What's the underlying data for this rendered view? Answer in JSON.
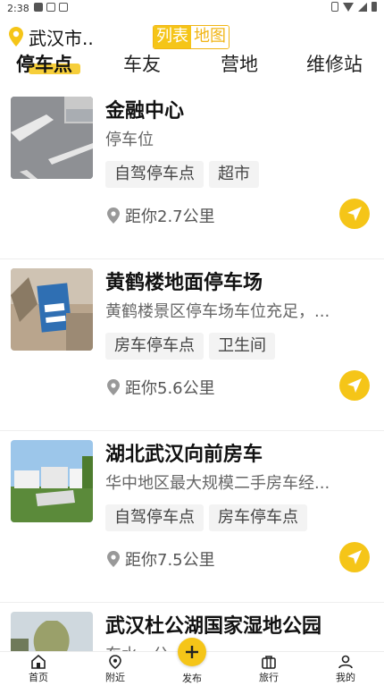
{
  "status_bar": {
    "time": "2:38"
  },
  "header": {
    "city": "武汉市..",
    "view_toggle": {
      "list": "列表",
      "map": "地图"
    }
  },
  "tabs": [
    {
      "label": "停车点",
      "active": true
    },
    {
      "label": "车友",
      "active": false
    },
    {
      "label": "营地",
      "active": false
    },
    {
      "label": "维修站",
      "active": false
    }
  ],
  "items": [
    {
      "title": "金融中心",
      "desc": "停车位",
      "tags": [
        "自驾停车点",
        "超市"
      ],
      "distance": "距你2.7公里"
    },
    {
      "title": "黄鹤楼地面停车场",
      "desc": "黄鹤楼景区停车场车位充足，...",
      "tags": [
        "房车停车点",
        "卫生间"
      ],
      "distance": "距你5.6公里"
    },
    {
      "title": "湖北武汉向前房车",
      "desc": "华中地区最大规模二手房车经...",
      "tags": [
        "自驾停车点",
        "房车停车点"
      ],
      "distance": "距你7.5公里"
    },
    {
      "title": "武汉杜公湖国家湿地公园",
      "desc": "东水...公...",
      "tags": [],
      "distance": ""
    }
  ],
  "bottom_nav": {
    "home": "首页",
    "nearby": "附近",
    "post": "发布",
    "travel": "旅行",
    "mine": "我的"
  },
  "colors": {
    "accent": "#f5c518",
    "accent_text": "#f1b515"
  }
}
